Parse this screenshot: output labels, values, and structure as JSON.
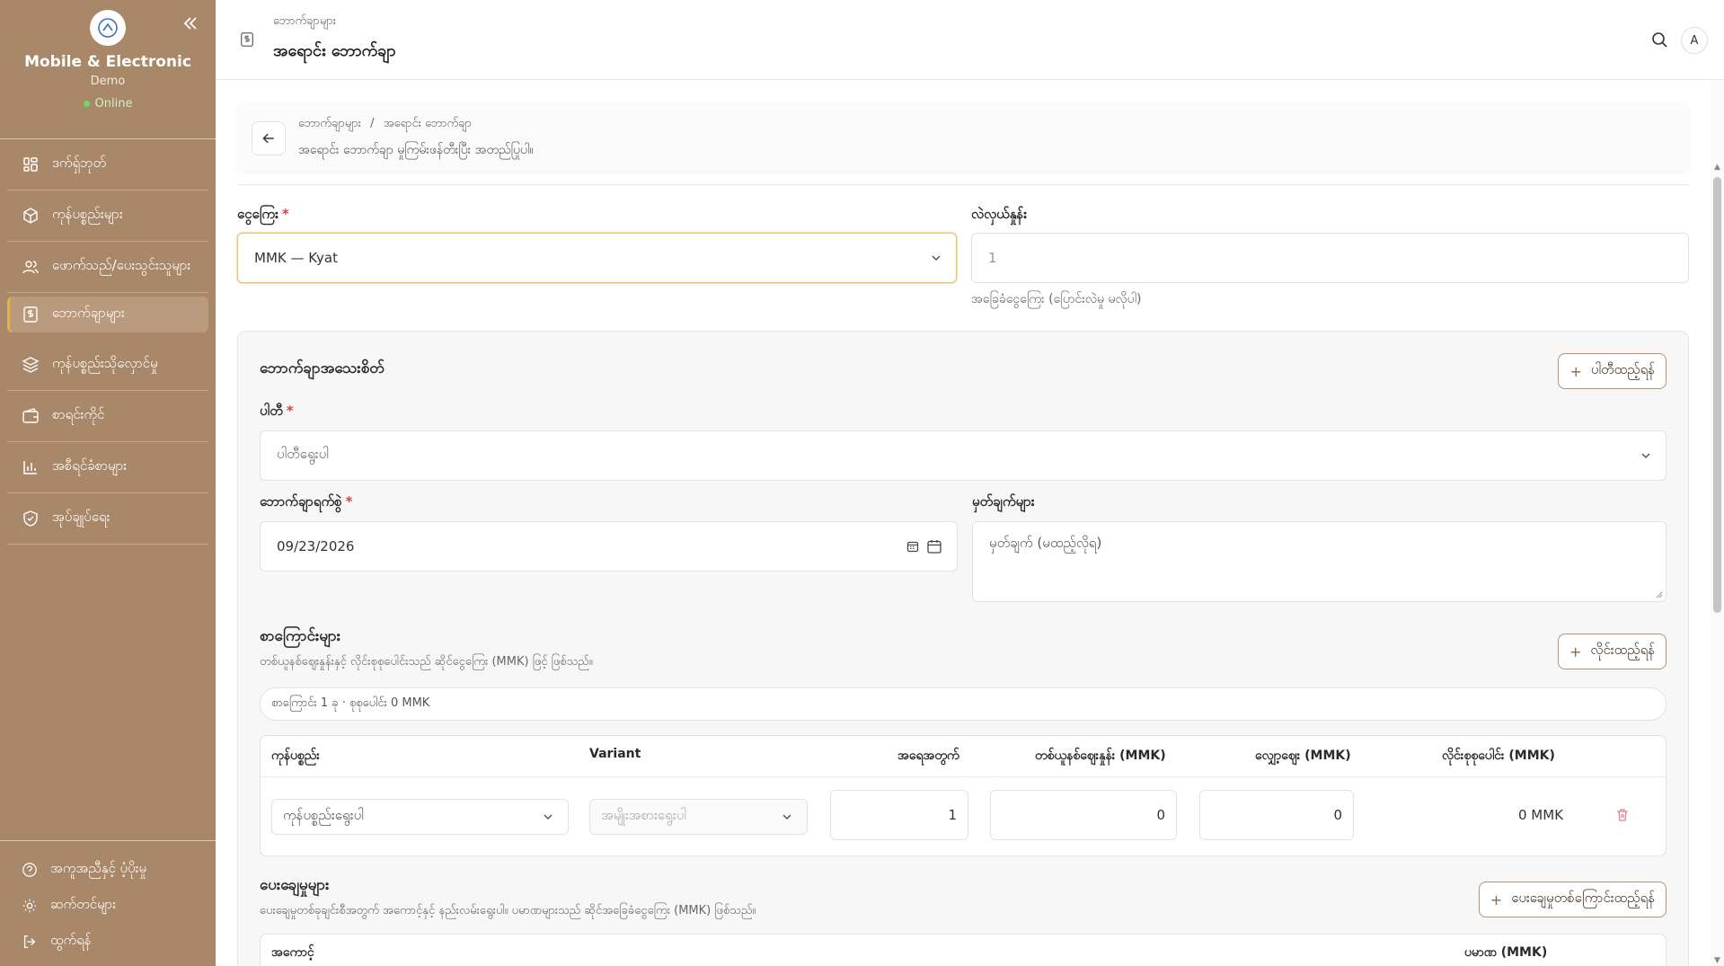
{
  "sidebar": {
    "brand": "Mobile & Electronic",
    "subtitle": "Demo",
    "status": "Online",
    "items": [
      {
        "label": "ဒက်ရှ်ဘုတ်",
        "icon": "dashboard-icon"
      },
      {
        "label": "ကုန်ပစ္စည်းများ",
        "icon": "box-icon"
      },
      {
        "label": "ဖောက်သည်/ပေးသွင်းသူများ",
        "icon": "users-icon"
      },
      {
        "label": "ဘောက်ချာများ",
        "icon": "receipt-dollar-icon",
        "active": true
      },
      {
        "label": "ကုန်ပစ္စည်းသိုလှောင်မှု",
        "icon": "layers-icon"
      },
      {
        "label": "စာရင်းကိုင်",
        "icon": "wallet-icon"
      },
      {
        "label": "အစီရင်ခံစာများ",
        "icon": "bar-chart-icon"
      },
      {
        "label": "အုပ်ချုပ်ရေး",
        "icon": "shield-check-icon"
      }
    ],
    "footer": [
      {
        "label": "အကူအညီနှင့် ပံ့ပိုးမှု",
        "icon": "help-circle-icon"
      },
      {
        "label": "ဆက်တင်များ",
        "icon": "gear-icon"
      },
      {
        "label": "ထွက်ရန်",
        "icon": "logout-icon"
      }
    ]
  },
  "header": {
    "breadcrumb": "ဘောက်ချာများ",
    "title": "အရောင်း ဘောက်ချာ",
    "avatar": "A"
  },
  "info": {
    "crumb_parent": "ဘောက်ချာများ",
    "crumb_sep": "/",
    "crumb_current": "အရောင်း ဘောက်ချာ",
    "description": "အရောင်း ဘောက်ချာ မှုကြမ်းဖန်တီးပြီး အတည်ပြုပါ။"
  },
  "form": {
    "currency_label": "ငွေကြေး",
    "currency_value": "MMK — Kyat",
    "rate_label": "လဲလှယ်နှုန်း",
    "rate_value": "1",
    "rate_hint": "အခြေခံငွေကြေး (ပြောင်းလဲမှု မလိုပါ)"
  },
  "voucher": {
    "title": "ဘောက်ချာအသေးစိတ်",
    "add_party": "ပါတီထည့်ရန်",
    "party_label": "ပါတီ",
    "party_placeholder": "ပါတီရွေးပါ",
    "date_label": "ဘောက်ချာရက်စွဲ",
    "date_value": "09/23/2026",
    "notes_label": "မှတ်ချက်များ",
    "notes_placeholder": "မှတ်ချက် (မထည့်လိုရ)"
  },
  "lines": {
    "title": "စာကြောင်းများ",
    "subtitle": "တစ်ယူနစ်ဈေးနှုန်းနှင့် လိုင်းစုစုပေါင်းသည် ဆိုင်ငွေကြေး (MMK) ဖြင့် ဖြစ်သည်။",
    "add_line": "လိုင်းထည့်ရန်",
    "summary": "စာကြောင်း 1 ခု · စုစုပေါင်း 0 MMK",
    "columns": [
      "ကုန်ပစ္စည်း",
      "Variant",
      "အရေအတွက်",
      "တစ်ယူနစ်ဈေးနှုန်း (MMK)",
      "လျှော့ဈေး (MMK)",
      "လိုင်းစုစုပေါင်း (MMK)"
    ],
    "rows": [
      {
        "product_placeholder": "ကုန်ပစ္စည်းရွေးပါ",
        "variant_placeholder": "အမျိုးအစားရွေးပါ",
        "qty": "1",
        "unit_price": "0",
        "discount": "0",
        "total": "0 MMK"
      }
    ]
  },
  "payments": {
    "title": "ပေးချေမှုများ",
    "subtitle": "ပေးချေမှုတစ်ခုချင်းစီအတွက် အကောင့်နှင့် နည်းလမ်းရွေးပါ။ ပမာဏများသည် ဆိုင်အခြေခံငွေကြေး (MMK) ဖြစ်သည်။",
    "add_payment": "ပေးချေမှုတစ်ကြောင်းထည့်ရန်",
    "columns": [
      "အကောင့်",
      "ပမာဏ (MMK)"
    ]
  },
  "colors": {
    "sidebar": "#a88869",
    "accent": "#e7b14a",
    "online": "#6bd86a",
    "danger": "#d9463f"
  }
}
